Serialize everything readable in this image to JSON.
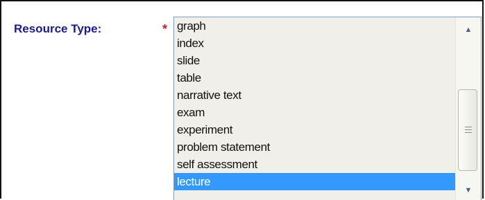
{
  "form": {
    "field_label": "Resource Type:",
    "required_marker": "*"
  },
  "listbox": {
    "options": [
      "graph",
      "index",
      "slide",
      "table",
      "narrative text",
      "exam",
      "experiment",
      "problem statement",
      "self assessment",
      "lecture"
    ],
    "selected": "lecture"
  },
  "scrollbar": {
    "up_arrow_icon": "chevron-up-icon",
    "down_arrow_icon": "chevron-down-icon",
    "up_glyph": "▲",
    "down_glyph": "▼"
  },
  "colors": {
    "label": "#1a1a8c",
    "required": "#d81a1a",
    "selection": "#3399ff",
    "list_background": "#f1efe9"
  }
}
